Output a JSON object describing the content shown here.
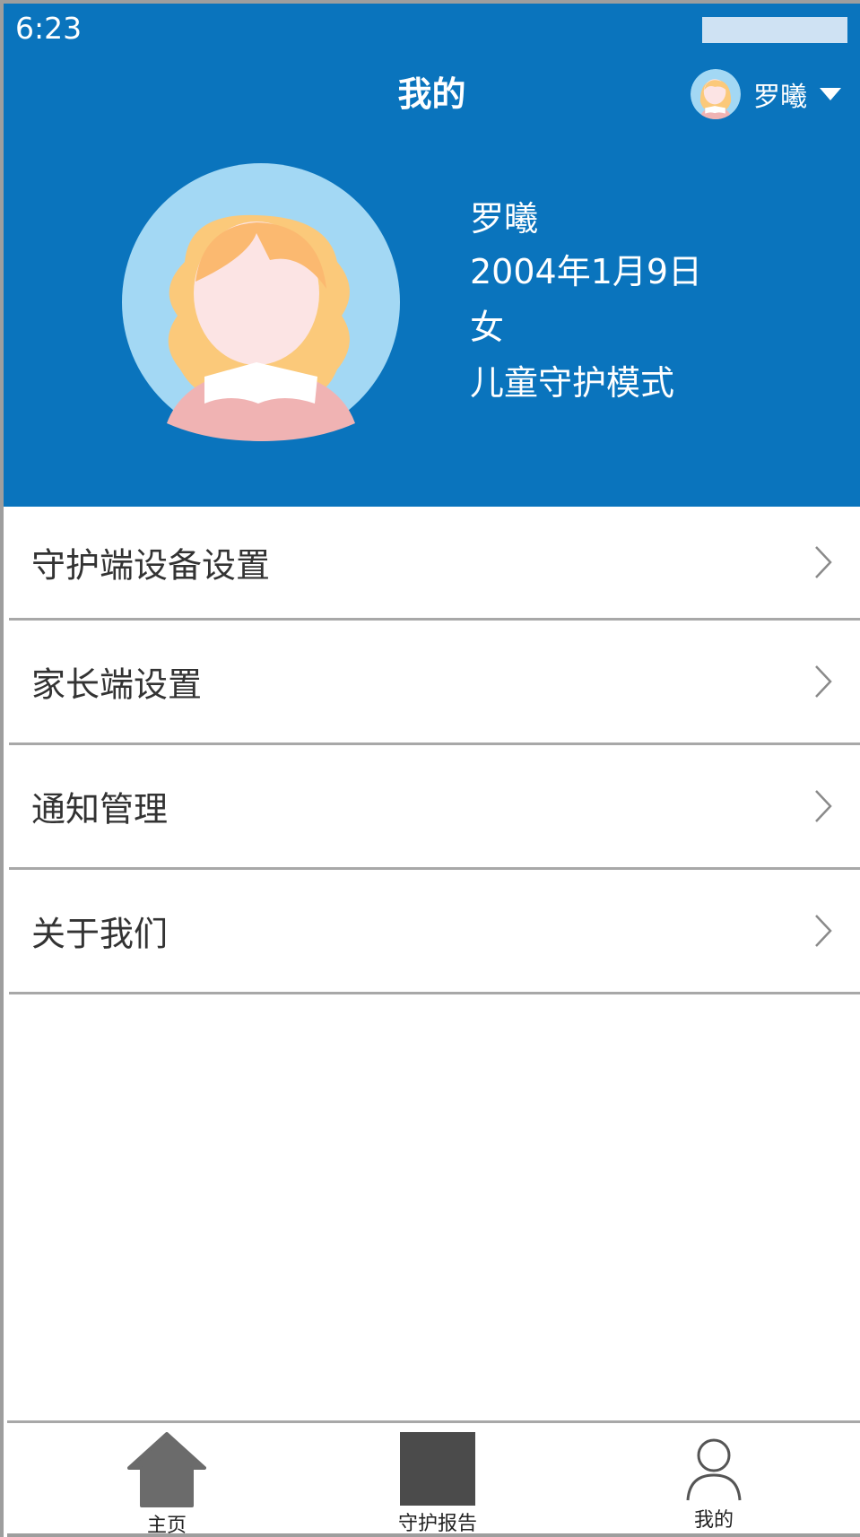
{
  "status_bar": {
    "time": "6:23"
  },
  "header": {
    "title": "我的",
    "current_user": "罗曦"
  },
  "profile": {
    "name": "罗曦",
    "birthday": "2004年1月9日",
    "gender": "女",
    "mode": "儿童守护模式"
  },
  "menu": [
    {
      "label": "守护端设备设置",
      "icon": "chevron-right-icon"
    },
    {
      "label": "家长端设置",
      "icon": "chevron-right-icon"
    },
    {
      "label": "通知管理",
      "icon": "chevron-right-icon"
    },
    {
      "label": "关于我们",
      "icon": "chevron-right-icon"
    }
  ],
  "tabbar": [
    {
      "label": "主页",
      "icon": "home-icon"
    },
    {
      "label": "守护报告",
      "icon": "report-icon"
    },
    {
      "label": "我的",
      "icon": "user-icon"
    }
  ],
  "colors": {
    "header_bg": "#0a74bd",
    "avatar_bg": "#a3d8f4",
    "divider": "#a8a8a8",
    "tab_icon": "#6b6b6b"
  }
}
